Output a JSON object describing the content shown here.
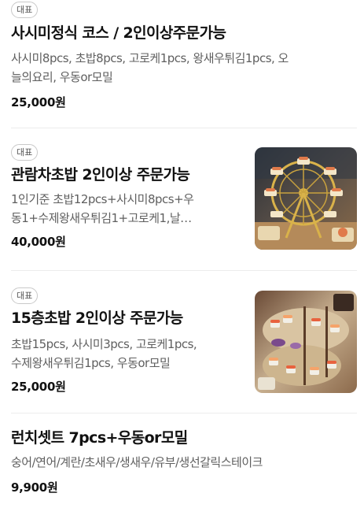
{
  "menu": {
    "items": [
      {
        "badge": "대표",
        "title": "사시미정식 코스 / 2인이상주문가능",
        "description_lines": [
          "사시미8pcs, 초밥8pcs, 고로케1pcs, 왕새우튀김1pcs, 오",
          "늘의요리, 우동or모밀"
        ],
        "price": "25,000원"
      },
      {
        "badge": "대표",
        "title": "관람차초밥 2인이상 주문가능",
        "description_lines": [
          "1인기준 초밥12pcs+사시미8pcs+우",
          "동1+수제왕새우튀김1+고로케1,날…"
        ],
        "price": "40,000원",
        "image": "ferris-wheel-sushi-photo"
      },
      {
        "badge": "대표",
        "title": "15층초밥 2인이상 주문가능",
        "description_lines": [
          "초밥15pcs, 사시미3pcs, 고로케1pcs,",
          "수제왕새우튀김1pcs, 우동or모밀"
        ],
        "price": "25,000원",
        "image": "tiered-sushi-tower-photo"
      },
      {
        "title": "런치셋트 7pcs+우동or모밀",
        "description_lines": [
          "숭어/연어/계란/초새우/생새우/유부/생선갈릭스테이크"
        ],
        "price": "9,900원"
      }
    ]
  }
}
